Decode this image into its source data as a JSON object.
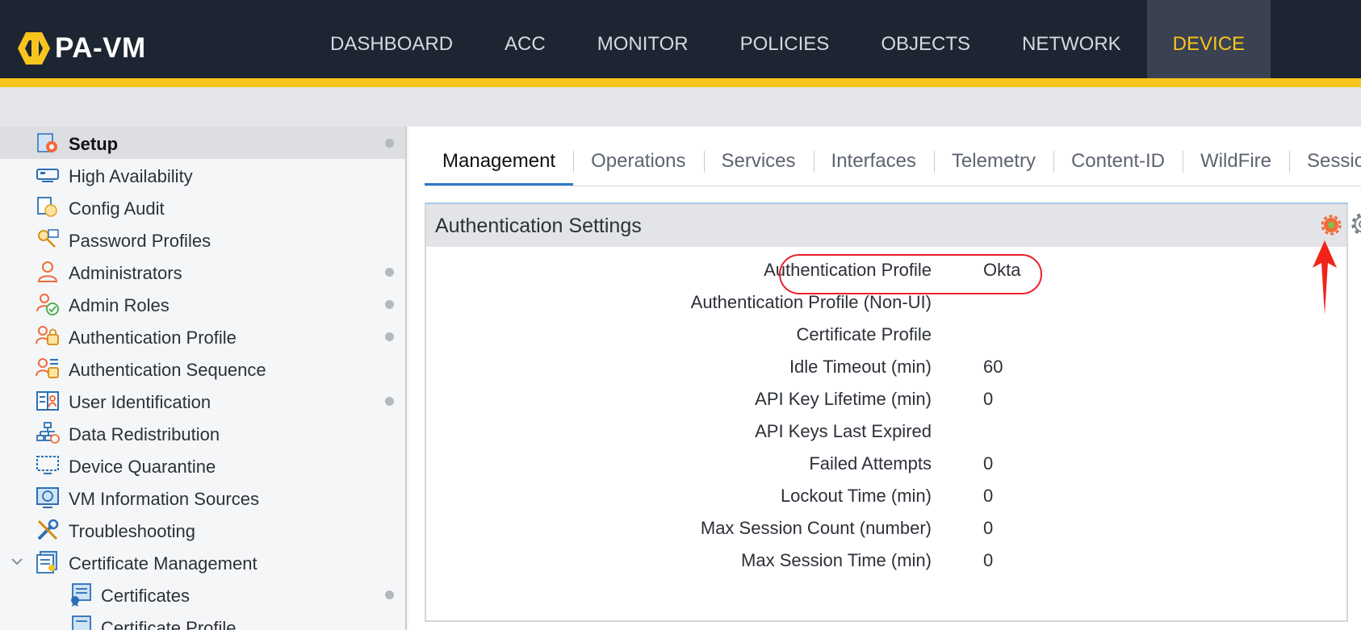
{
  "app": {
    "name": "PA-VM"
  },
  "nav": {
    "items": [
      "DASHBOARD",
      "ACC",
      "MONITOR",
      "POLICIES",
      "OBJECTS",
      "NETWORK",
      "DEVICE"
    ],
    "active": "DEVICE"
  },
  "sidebar": {
    "items": [
      {
        "label": "Setup",
        "icon": "setup-icon",
        "active": true,
        "dot": true
      },
      {
        "label": "High Availability",
        "icon": "high-availability-icon",
        "dot": false
      },
      {
        "label": "Config Audit",
        "icon": "config-audit-icon",
        "dot": false
      },
      {
        "label": "Password Profiles",
        "icon": "password-profiles-icon",
        "dot": false
      },
      {
        "label": "Administrators",
        "icon": "administrators-icon",
        "dot": true
      },
      {
        "label": "Admin Roles",
        "icon": "admin-roles-icon",
        "dot": true
      },
      {
        "label": "Authentication Profile",
        "icon": "authentication-profile-icon",
        "dot": true
      },
      {
        "label": "Authentication Sequence",
        "icon": "authentication-sequence-icon",
        "dot": false
      },
      {
        "label": "User Identification",
        "icon": "user-identification-icon",
        "dot": true
      },
      {
        "label": "Data Redistribution",
        "icon": "data-redistribution-icon",
        "dot": false
      },
      {
        "label": "Device Quarantine",
        "icon": "device-quarantine-icon",
        "dot": false
      },
      {
        "label": "VM Information Sources",
        "icon": "vm-information-sources-icon",
        "dot": false
      },
      {
        "label": "Troubleshooting",
        "icon": "troubleshooting-icon",
        "dot": false
      },
      {
        "label": "Certificate Management",
        "icon": "certificate-management-icon",
        "dot": false,
        "expanded": true
      },
      {
        "label": "Certificates",
        "icon": "certificates-icon",
        "dot": true,
        "child": true
      },
      {
        "label": "Certificate Profile",
        "icon": "certificate-profile-icon",
        "dot": false,
        "child": true
      }
    ]
  },
  "tabs": [
    "Management",
    "Operations",
    "Services",
    "Interfaces",
    "Telemetry",
    "Content-ID",
    "WildFire",
    "Session"
  ],
  "active_tab": "Management",
  "panel": {
    "title": "Authentication Settings",
    "rows": [
      {
        "key": "Authentication Profile",
        "value": "Okta"
      },
      {
        "key": "Authentication Profile (Non-UI)",
        "value": ""
      },
      {
        "key": "Certificate Profile",
        "value": ""
      },
      {
        "key": "Idle Timeout (min)",
        "value": "60"
      },
      {
        "key": "API Key Lifetime (min)",
        "value": "0"
      },
      {
        "key": "API Keys Last Expired",
        "value": ""
      },
      {
        "key": "Failed Attempts",
        "value": "0"
      },
      {
        "key": "Lockout Time (min)",
        "value": "0"
      },
      {
        "key": "Max Session Count (number)",
        "value": "0"
      },
      {
        "key": "Max Session Time (min)",
        "value": "0"
      }
    ]
  },
  "colors": {
    "topbar": "#1e2532",
    "accent": "#f7c51d",
    "tab_underline": "#2b78c8",
    "highlight": "#e8202a"
  }
}
